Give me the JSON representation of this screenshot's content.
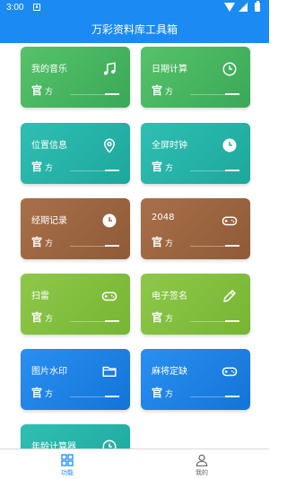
{
  "status_bar": {
    "time": "3:00"
  },
  "header": {
    "title": "万彩资料库工具箱"
  },
  "card_common": {
    "guan": "官",
    "fang": "方"
  },
  "cards": [
    {
      "label": "我的音乐",
      "icon": "music-note-icon",
      "color": "#48b862"
    },
    {
      "label": "日期计算",
      "icon": "clock-icon",
      "color": "#48b862"
    },
    {
      "label": "位置信息",
      "icon": "location-pin-icon",
      "color": "#28b6aa"
    },
    {
      "label": "全屏时钟",
      "icon": "clock-icon",
      "color": "#28b6aa"
    },
    {
      "label": "经期记录",
      "icon": "clock-icon",
      "color": "#9c6541"
    },
    {
      "label": "2048",
      "icon": "gamepad-icon",
      "color": "#9c6541"
    },
    {
      "label": "扫雷",
      "icon": "gamepad-icon",
      "color": "#82bf3f"
    },
    {
      "label": "电子签名",
      "icon": "pencil-icon",
      "color": "#82bf3f"
    },
    {
      "label": "图片水印",
      "icon": "folder-icon",
      "color": "#1f84e6"
    },
    {
      "label": "麻将定缺",
      "icon": "gamepad-icon",
      "color": "#1f84e6"
    },
    {
      "label": "年龄计算器",
      "icon": "clock-icon",
      "color": "#28b6aa"
    }
  ],
  "tabbar": {
    "items": [
      {
        "label": "功能",
        "icon": "grid-icon",
        "active": true
      },
      {
        "label": "我的",
        "icon": "user-icon",
        "active": false
      }
    ]
  },
  "colors": {
    "primary": "#1b8bf3"
  }
}
